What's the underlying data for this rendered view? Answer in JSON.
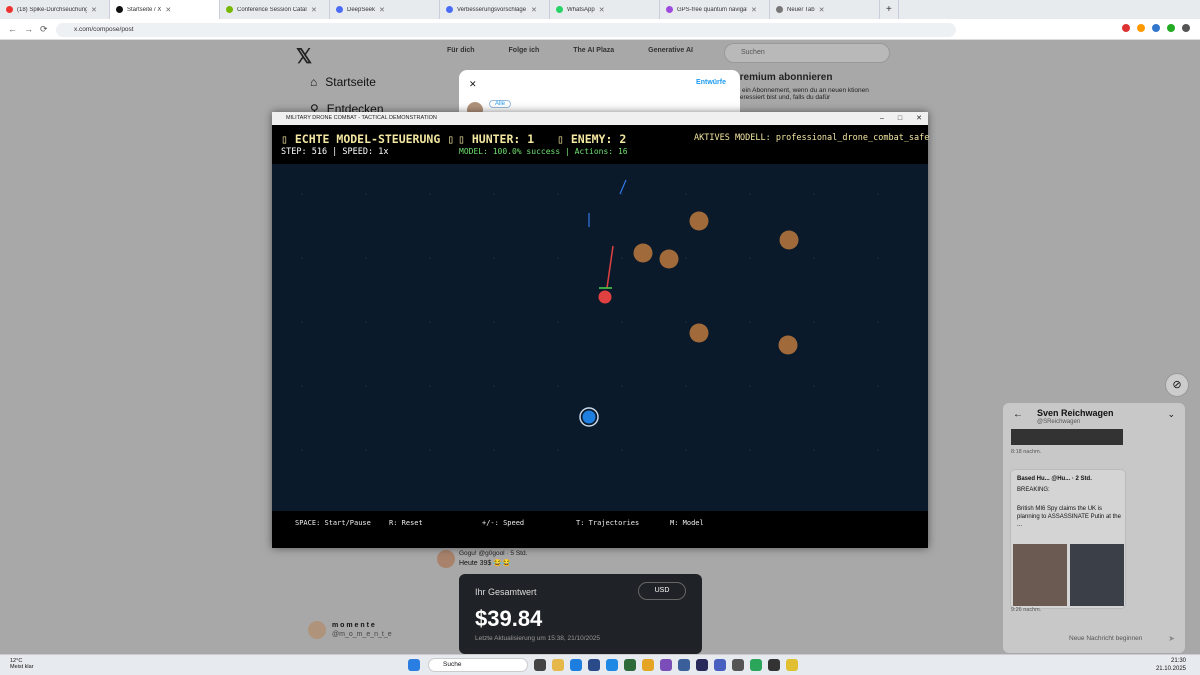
{
  "browser": {
    "tabs": [
      {
        "title": "(18) Spike-Durchseuchung",
        "color": "#e33"
      },
      {
        "title": "Startseite / X",
        "color": "#111",
        "active": true
      },
      {
        "title": "Conference Session Catalog | N",
        "color": "#76b900"
      },
      {
        "title": "DeepSeek",
        "color": "#4a6cf7"
      },
      {
        "title": "Verbesserungsvorschläge für D",
        "color": "#4a6cf7"
      },
      {
        "title": "WhatsApp",
        "color": "#25d366"
      },
      {
        "title": "GPS-free quantum navigation",
        "color": "#a04be0"
      },
      {
        "title": "Neuer Tab",
        "color": "#777"
      }
    ],
    "url": "x.com/compose/post"
  },
  "x": {
    "logo": "𝕏",
    "nav_home": "Startseite",
    "nav_explore": "Entdecken",
    "feed_tabs": [
      "Für dich",
      "Folge ich",
      "The AI Plaza",
      "Generative AI"
    ],
    "search_placeholder": "Suchen",
    "premium_title": "Premium abonnieren",
    "premium_text": "dir ein Abonnement, wenn du an neuen ktionen interessiert bist und, falls du dafür",
    "compose_close": "✕",
    "compose_drafts": "Entwürfe",
    "compose_audience": "Alle",
    "profile_name": "m o m e n t e",
    "profile_handle": "@m_o_m_e_n_t_e",
    "tweet_header": "Gogu! @g0gool · 5 Std.",
    "tweet_body": "Heute 39$ 😂😂",
    "wallet_label": "Ihr Gesamtwert",
    "wallet_currency": "USD",
    "wallet_value": "$39.84",
    "wallet_updated": "Letzte Aktualisierung um 15:38, 21/10/2025"
  },
  "chat": {
    "name": "Sven Reichwagen",
    "handle": "@SReichwagen",
    "time1": "8:18 nachm.",
    "card_header": "Based Hu... @Hu... · 2 Std.",
    "card_breaking": "BREAKING:",
    "card_text": "British MI6 Spy claims the UK is planning to ASSASSINATE Putin at the ...",
    "time2": "9:26 nachm.",
    "input_placeholder": "Neue Nachricht beginnen"
  },
  "game": {
    "window_title": "MILITARY DRONE COMBAT - TACTICAL DEMONSTRATION",
    "hud_title": "ECHTE MODEL-STEUERUNG",
    "hunter": "HUNTER: 1",
    "enemy": "ENEMY: 2",
    "step_speed": "STEP: 516 | SPEED: 1x",
    "model_status": "MODEL: 100.0% success | Actions: 16",
    "active_model": "AKTIVES MODELL: professional_drone_combat_safe",
    "controls": [
      "SPACE: Start/Pause",
      "R: Reset",
      "+/-: Speed",
      "T: Trajectories",
      "M: Model"
    ],
    "colors": {
      "hunter": "#e04040",
      "player": "#1e7fe0",
      "obstacle": "#a06a3a",
      "arena": "#0a1a2a"
    }
  },
  "taskbar": {
    "weather_temp": "12°C",
    "weather_text": "Meist klar",
    "search": "Suche",
    "time": "21:30",
    "date": "21.10.2025"
  }
}
